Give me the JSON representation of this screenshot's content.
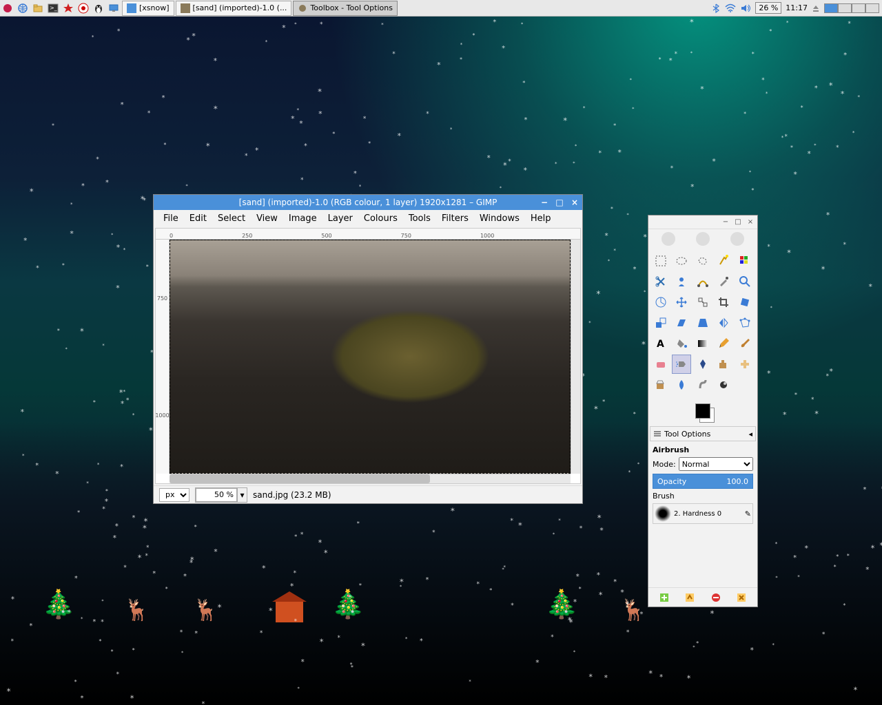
{
  "taskbar": {
    "tasks": [
      {
        "label": "[xsnow]"
      },
      {
        "label": "[sand] (imported)-1.0 (..."
      },
      {
        "label": "Toolbox - Tool Options"
      }
    ],
    "battery": "26 %",
    "clock": "11:17"
  },
  "gimp": {
    "title": "[sand] (imported)-1.0 (RGB colour, 1 layer) 1920x1281 – GIMP",
    "menu": [
      "File",
      "Edit",
      "Select",
      "View",
      "Image",
      "Layer",
      "Colours",
      "Tools",
      "Filters",
      "Windows",
      "Help"
    ],
    "ruler_h": [
      "0",
      "250",
      "500",
      "750",
      "1000"
    ],
    "ruler_v": [
      "750",
      "1000"
    ],
    "status": {
      "unit": "px",
      "zoom": "50 %",
      "file": "sand.jpg (23.2 MB)"
    }
  },
  "toolbox": {
    "options_title": "Tool Options",
    "tool_name": "Airbrush",
    "mode_label": "Mode:",
    "mode_value": "Normal",
    "opacity_label": "Opacity",
    "opacity_value": "100.0",
    "brush_label": "Brush",
    "brush_name": "2. Hardness 0"
  }
}
